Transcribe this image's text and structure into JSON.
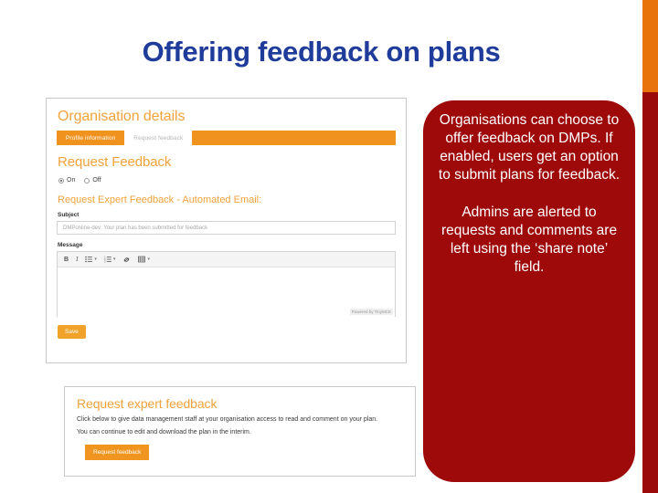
{
  "slide": {
    "title": "Offering feedback on plans",
    "title_color": "#1F3C9B",
    "background": "#FFFFFF"
  },
  "decor": {
    "orange_bar_color": "#E8730C",
    "red_bar_color": "#9B0A0A"
  },
  "callout": {
    "background": "#9E0A0A",
    "text_color": "#FFFFFF",
    "paragraphs": [
      "Organisations can choose to offer feedback on DMPs. If enabled, users get an option to submit plans for feedback.",
      "Admins are alerted to requests and comments are left using the ‘share note’ field."
    ]
  },
  "org_screenshot": {
    "heading": "Organisation details",
    "tabs": [
      {
        "label": "Profile information",
        "active": false
      },
      {
        "label": "Request feedback",
        "active": true
      }
    ],
    "section_heading": "Request Feedback",
    "toggle": {
      "options": [
        {
          "label": "On",
          "selected": true
        },
        {
          "label": "Off",
          "selected": false
        }
      ]
    },
    "email_heading": "Request Expert Feedback - Automated Email:",
    "subject": {
      "label": "Subject",
      "value": "DMPonline-dev: Your plan has been submitted for feedback"
    },
    "message": {
      "label": "Message",
      "value": "",
      "toolbar": [
        {
          "name": "bold-icon",
          "glyph": "B"
        },
        {
          "name": "italic-icon",
          "glyph": "I"
        },
        {
          "name": "bullet-list-icon",
          "glyph": ""
        },
        {
          "name": "numbered-list-icon",
          "glyph": ""
        },
        {
          "name": "link-icon",
          "glyph": ""
        },
        {
          "name": "table-icon",
          "glyph": ""
        }
      ],
      "powered_by": "Powered by TinyMCE"
    },
    "save_label": "Save",
    "accent_color": "#F0921E"
  },
  "expert_screenshot": {
    "heading": "Request expert feedback",
    "paragraph_1": "Click below to give data management staff at your organisation access to read and comment on your plan.",
    "paragraph_2": "You can continue to edit and download the plan in the interim.",
    "button_label": "Request feedback",
    "accent_color": "#F0951F"
  }
}
